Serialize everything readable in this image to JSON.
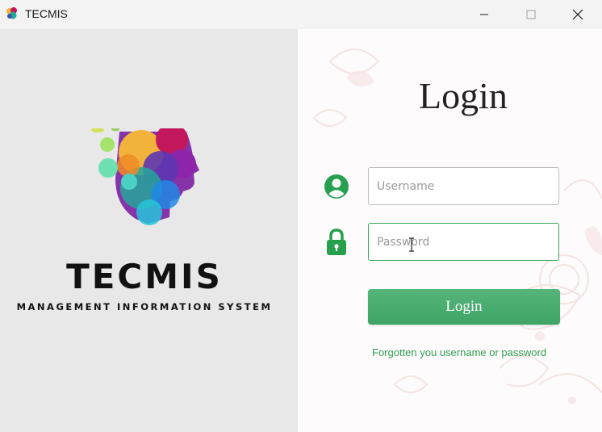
{
  "window": {
    "title": "TECMIS",
    "controls": [
      "minimize-icon",
      "maximize-icon",
      "close-icon"
    ]
  },
  "branding": {
    "name": "TECMIS",
    "tagline": "MANAGEMENT INFORMATION SYSTEM",
    "logo_icon": "brain-head-logo"
  },
  "login": {
    "heading": "Login",
    "username_placeholder": "Username",
    "password_placeholder": "Password",
    "username_value": "",
    "password_value": "",
    "button_label": "Login",
    "forgot_link": "Forgotten you username or password"
  },
  "colors": {
    "accent": "#3ea465",
    "left_panel_bg": "#e8e8e8",
    "titlebar_bg": "#f3f3f3"
  }
}
